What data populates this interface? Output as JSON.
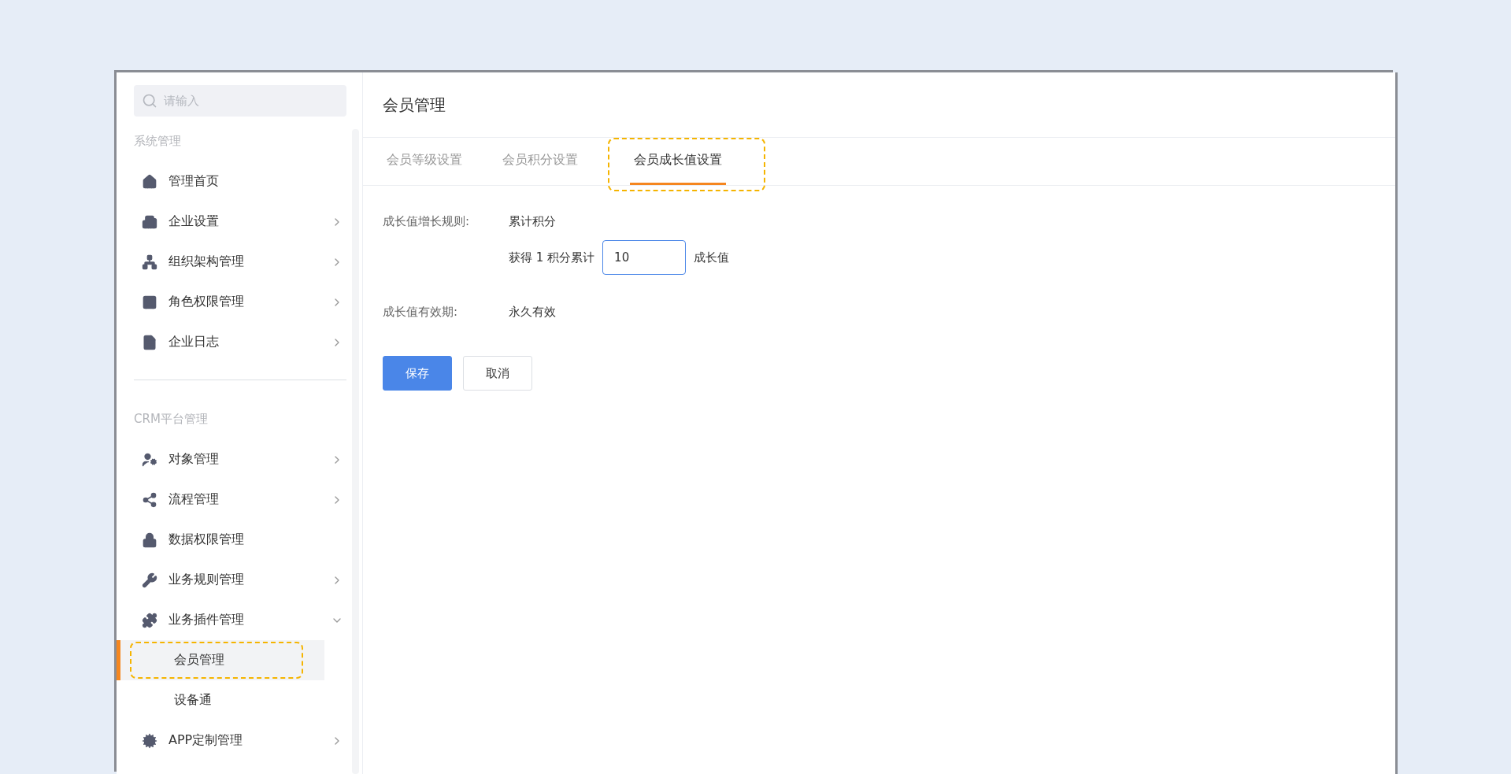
{
  "search": {
    "placeholder": "请输入"
  },
  "sidebar": {
    "sections": [
      {
        "title": "系统管理",
        "items": [
          {
            "label": "管理首页"
          },
          {
            "label": "企业设置",
            "expanded": false
          },
          {
            "label": "组织架构管理",
            "expanded": false
          },
          {
            "label": "角色权限管理",
            "expanded": false
          },
          {
            "label": "企业日志",
            "expanded": false
          }
        ]
      },
      {
        "title": "CRM平台管理",
        "items": [
          {
            "label": "对象管理",
            "expanded": false
          },
          {
            "label": "流程管理",
            "expanded": false
          },
          {
            "label": "数据权限管理"
          },
          {
            "label": "业务规则管理",
            "expanded": false
          },
          {
            "label": "业务插件管理",
            "expanded": true,
            "children": [
              {
                "label": "会员管理",
                "selected": true,
                "highlighted": true
              },
              {
                "label": "设备通",
                "selected": false,
                "highlighted": false
              }
            ]
          },
          {
            "label": "APP定制管理",
            "expanded": false
          }
        ]
      }
    ]
  },
  "page_title": "会员管理",
  "tabs": [
    {
      "label": "会员等级设置",
      "selected": false,
      "highlighted": false
    },
    {
      "label": "会员积分设置",
      "selected": false,
      "highlighted": false
    },
    {
      "label": "会员成长值设置",
      "selected": true,
      "highlighted": true
    }
  ],
  "form": {
    "rule_label": "成长值增长规则:",
    "rule_value": "累计积分",
    "rule_prefix": "获得 1 积分累计",
    "rule_input": "10",
    "rule_suffix": "成长值",
    "validity_label": "成长值有效期:",
    "validity_value": "永久有效"
  },
  "buttons": [
    {
      "label": "保存",
      "kind": "primary"
    },
    {
      "label": "取消",
      "kind": "default"
    }
  ]
}
